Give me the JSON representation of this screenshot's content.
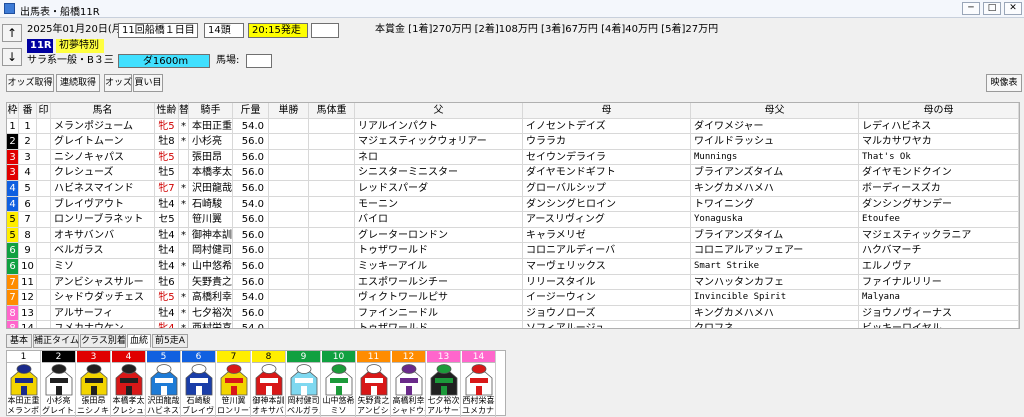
{
  "window": {
    "title": "出馬表・船橋11R",
    "min": "─",
    "max": "□",
    "close": "✕"
  },
  "race": {
    "date": "2025年01月20日(月)",
    "meeting": "11回船橋１日目",
    "runners": "14頭",
    "post_time": "20:15発走",
    "race_no": "11R",
    "race_name": "初夢特別",
    "class": "サラ系一般・B３三",
    "course": "ダ1600m",
    "track_label": "馬場:",
    "prize": "本賞金 [1着]270万円 [2着]108万円 [3着]67万円 [4着]40万円 [5着]27万円"
  },
  "nav": {
    "up": "↑",
    "down": "↓"
  },
  "toolbar": {
    "odds": "オッズ取得",
    "realtime_odds": "連続取得",
    "odds_buy": "オッズ",
    "buy": "買い目",
    "video": "映像表"
  },
  "table": {
    "headers": [
      "枠",
      "番",
      "印",
      "馬名",
      "性齢",
      "替",
      "騎手",
      "斤量",
      "単勝",
      "馬体重",
      "父",
      "母",
      "母父",
      "母の母"
    ],
    "rows": [
      {
        "waku": "1",
        "num": "1",
        "mark": "",
        "name": "メランポジューム",
        "sex_age": "牝5",
        "change": "*",
        "jockey": "本田正重",
        "weight": "54.0",
        "win": "",
        "body": "",
        "sire": "リアルインパクト",
        "dam": "イノセントデイズ",
        "damsire": "ダイワメジャー",
        "damdam": "レディハビネス"
      },
      {
        "waku": "2",
        "num": "2",
        "mark": "",
        "name": "グレイトムーン",
        "sex_age": "牡8",
        "change": "*",
        "jockey": "小杉亮",
        "weight": "56.0",
        "win": "",
        "body": "",
        "sire": "マジェスティックウォリアー",
        "dam": "ウララカ",
        "damsire": "ワイルドラッシュ",
        "damdam": "マルカサワヤカ"
      },
      {
        "waku": "3",
        "num": "3",
        "mark": "",
        "name": "ニシノキャパス",
        "sex_age": "牝5",
        "change": "",
        "jockey": "張田昂",
        "weight": "56.0",
        "win": "",
        "body": "",
        "sire": "ネロ",
        "dam": "セイウンデライラ",
        "damsire": "Munnings",
        "damdam": "That's Ok"
      },
      {
        "waku": "3",
        "num": "4",
        "mark": "",
        "name": "クレシューズ",
        "sex_age": "牡5",
        "change": "",
        "jockey": "本橋孝太",
        "weight": "56.0",
        "win": "",
        "body": "",
        "sire": "シニスターミニスター",
        "dam": "ダイヤモンドギフト",
        "damsire": "ブライアンズタイム",
        "damdam": "ダイヤモンドクイン"
      },
      {
        "waku": "4",
        "num": "5",
        "mark": "",
        "name": "ハビネスマインド",
        "sex_age": "牝7",
        "change": "*",
        "jockey": "沢田龍哉",
        "weight": "56.0",
        "win": "",
        "body": "",
        "sire": "レッドスパーダ",
        "dam": "グローバルシップ",
        "damsire": "キングカメハメハ",
        "damdam": "ボーディースズカ"
      },
      {
        "waku": "4",
        "num": "6",
        "mark": "",
        "name": "ブレイヴアウト",
        "sex_age": "牡4",
        "change": "*",
        "jockey": "石崎駿",
        "weight": "54.0",
        "win": "",
        "body": "",
        "sire": "モーニン",
        "dam": "ダンシングヒロイン",
        "damsire": "トワイニング",
        "damdam": "ダンシングサンデー"
      },
      {
        "waku": "5",
        "num": "7",
        "mark": "",
        "name": "ロンリーブラネット",
        "sex_age": "セ5",
        "change": "",
        "jockey": "笹川翼",
        "weight": "56.0",
        "win": "",
        "body": "",
        "sire": "バイロ",
        "dam": "アースリヴィング",
        "damsire": "Yonaguska",
        "damdam": "Etoufee"
      },
      {
        "waku": "5",
        "num": "8",
        "mark": "",
        "name": "オキサバンバ",
        "sex_age": "牡4",
        "change": "*",
        "jockey": "御神本訓",
        "weight": "56.0",
        "win": "",
        "body": "",
        "sire": "グレーターロンドン",
        "dam": "キャラメリゼ",
        "damsire": "ブライアンズタイム",
        "damdam": "マジェスティックラニア"
      },
      {
        "waku": "6",
        "num": "9",
        "mark": "",
        "name": "ベルガラス",
        "sex_age": "牡4",
        "change": "",
        "jockey": "岡村健司",
        "weight": "56.0",
        "win": "",
        "body": "",
        "sire": "トゥザワールド",
        "dam": "コロニアルディーバ",
        "damsire": "コロニアルアッフェアー",
        "damdam": "ハクバマーチ"
      },
      {
        "waku": "6",
        "num": "10",
        "mark": "",
        "name": "ミソ",
        "sex_age": "牡4",
        "change": "*",
        "jockey": "山中悠希",
        "weight": "56.0",
        "win": "",
        "body": "",
        "sire": "ミッキーアイル",
        "dam": "マーヴェリックス",
        "damsire": "Smart Strike",
        "damdam": "エルノヴァ"
      },
      {
        "waku": "7",
        "num": "11",
        "mark": "",
        "name": "アンビシャスサルー",
        "sex_age": "牡6",
        "change": "",
        "jockey": "矢野貴之",
        "weight": "56.0",
        "win": "",
        "body": "",
        "sire": "エスポワールシチー",
        "dam": "リリースタイル",
        "damsire": "マンハッタンカフェ",
        "damdam": "ファイナルリリー"
      },
      {
        "waku": "7",
        "num": "12",
        "mark": "",
        "name": "シャドウダッチェス",
        "sex_age": "牝5",
        "change": "*",
        "jockey": "高橋利幸",
        "weight": "54.0",
        "win": "",
        "body": "",
        "sire": "ヴィクトワールピサ",
        "dam": "イージーウィン",
        "damsire": "Invincible Spirit",
        "damdam": "Malyana"
      },
      {
        "waku": "8",
        "num": "13",
        "mark": "",
        "name": "アルサーフィ",
        "sex_age": "牡4",
        "change": "*",
        "jockey": "七夕裕次",
        "weight": "56.0",
        "win": "",
        "body": "",
        "sire": "ファインニードル",
        "dam": "ジョウノローズ",
        "damsire": "キングカメハメハ",
        "damdam": "ジョウノヴィーナス"
      },
      {
        "waku": "8",
        "num": "14",
        "mark": "",
        "name": "ユメカナウケン",
        "sex_age": "牝4",
        "change": "*",
        "jockey": "西村栄喜",
        "weight": "54.0",
        "win": "",
        "body": "",
        "sire": "トゥザワールド",
        "dam": "ソフィアルージュ",
        "damsire": "クロフネ",
        "damdam": "ビッキーロイヤル"
      }
    ]
  },
  "tabs": [
    "基本",
    "補正タイム",
    "クラス別着",
    "血統",
    "前5走A"
  ],
  "silks": [
    {
      "num": "1",
      "jockey": "本田正重",
      "horse": "メランポジュ",
      "primary": "#f2d400",
      "secondary": "#1a2a8a"
    },
    {
      "num": "2",
      "jockey": "小杉亮",
      "horse": "グレイトム",
      "primary": "#ffffff",
      "secondary": "#202020"
    },
    {
      "num": "3",
      "jockey": "張田昂",
      "horse": "ニシノキャ",
      "primary": "#f2d400",
      "secondary": "#202020"
    },
    {
      "num": "4",
      "jockey": "本橋孝太",
      "horse": "クレシュー",
      "primary": "#d81818",
      "secondary": "#202020"
    },
    {
      "num": "5",
      "jockey": "沢田龍哉",
      "horse": "ハビネスマ",
      "primary": "#1e7bd6",
      "secondary": "#ffffff"
    },
    {
      "num": "6",
      "jockey": "石崎駿",
      "horse": "ブレイヴア",
      "primary": "#1a3ea8",
      "secondary": "#ffffff"
    },
    {
      "num": "7",
      "jockey": "笹川翼",
      "horse": "ロンリーブ",
      "primary": "#f2d400",
      "secondary": "#d81818"
    },
    {
      "num": "8",
      "jockey": "御神本訓",
      "horse": "オキサバン",
      "primary": "#d81818",
      "secondary": "#ffffff"
    },
    {
      "num": "9",
      "jockey": "岡村健司",
      "horse": "ベルガラス",
      "primary": "#7fd8f0",
      "secondary": "#ffffff"
    },
    {
      "num": "10",
      "jockey": "山中悠希",
      "horse": "ミソ",
      "primary": "#ffffff",
      "secondary": "#1c9a3a"
    },
    {
      "num": "11",
      "jockey": "矢野貴之",
      "horse": "アンビシャ",
      "primary": "#d81818",
      "secondary": "#ffffff"
    },
    {
      "num": "12",
      "jockey": "高橋利幸",
      "horse": "シャドウダ",
      "primary": "#ffffff",
      "secondary": "#6a2a8a"
    },
    {
      "num": "13",
      "jockey": "七夕裕次",
      "horse": "アルサーフ",
      "primary": "#202020",
      "secondary": "#1c9a3a"
    },
    {
      "num": "14",
      "jockey": "西村栄喜",
      "horse": "ユメカナウ",
      "primary": "#ffffff",
      "secondary": "#d81818"
    }
  ],
  "colors": {
    "waku": {
      "1": "#ffffff",
      "2": "#000000",
      "3": "#e00000",
      "4": "#1060e0",
      "5": "#ffee00",
      "6": "#10a040",
      "7": "#ff8c00",
      "8": "#ff66cc"
    },
    "waku_text": {
      "1": "#000000",
      "2": "#ffffff",
      "3": "#ffffff",
      "4": "#ffffff",
      "5": "#000000",
      "6": "#ffffff",
      "7": "#ffffff",
      "8": "#ffffff"
    },
    "post_time_bg": "#ffff00",
    "race_no_bg": "#0000a0",
    "race_name_bg": "#ffff40",
    "course_bg": "#40e0ff",
    "female": "#d00000"
  }
}
